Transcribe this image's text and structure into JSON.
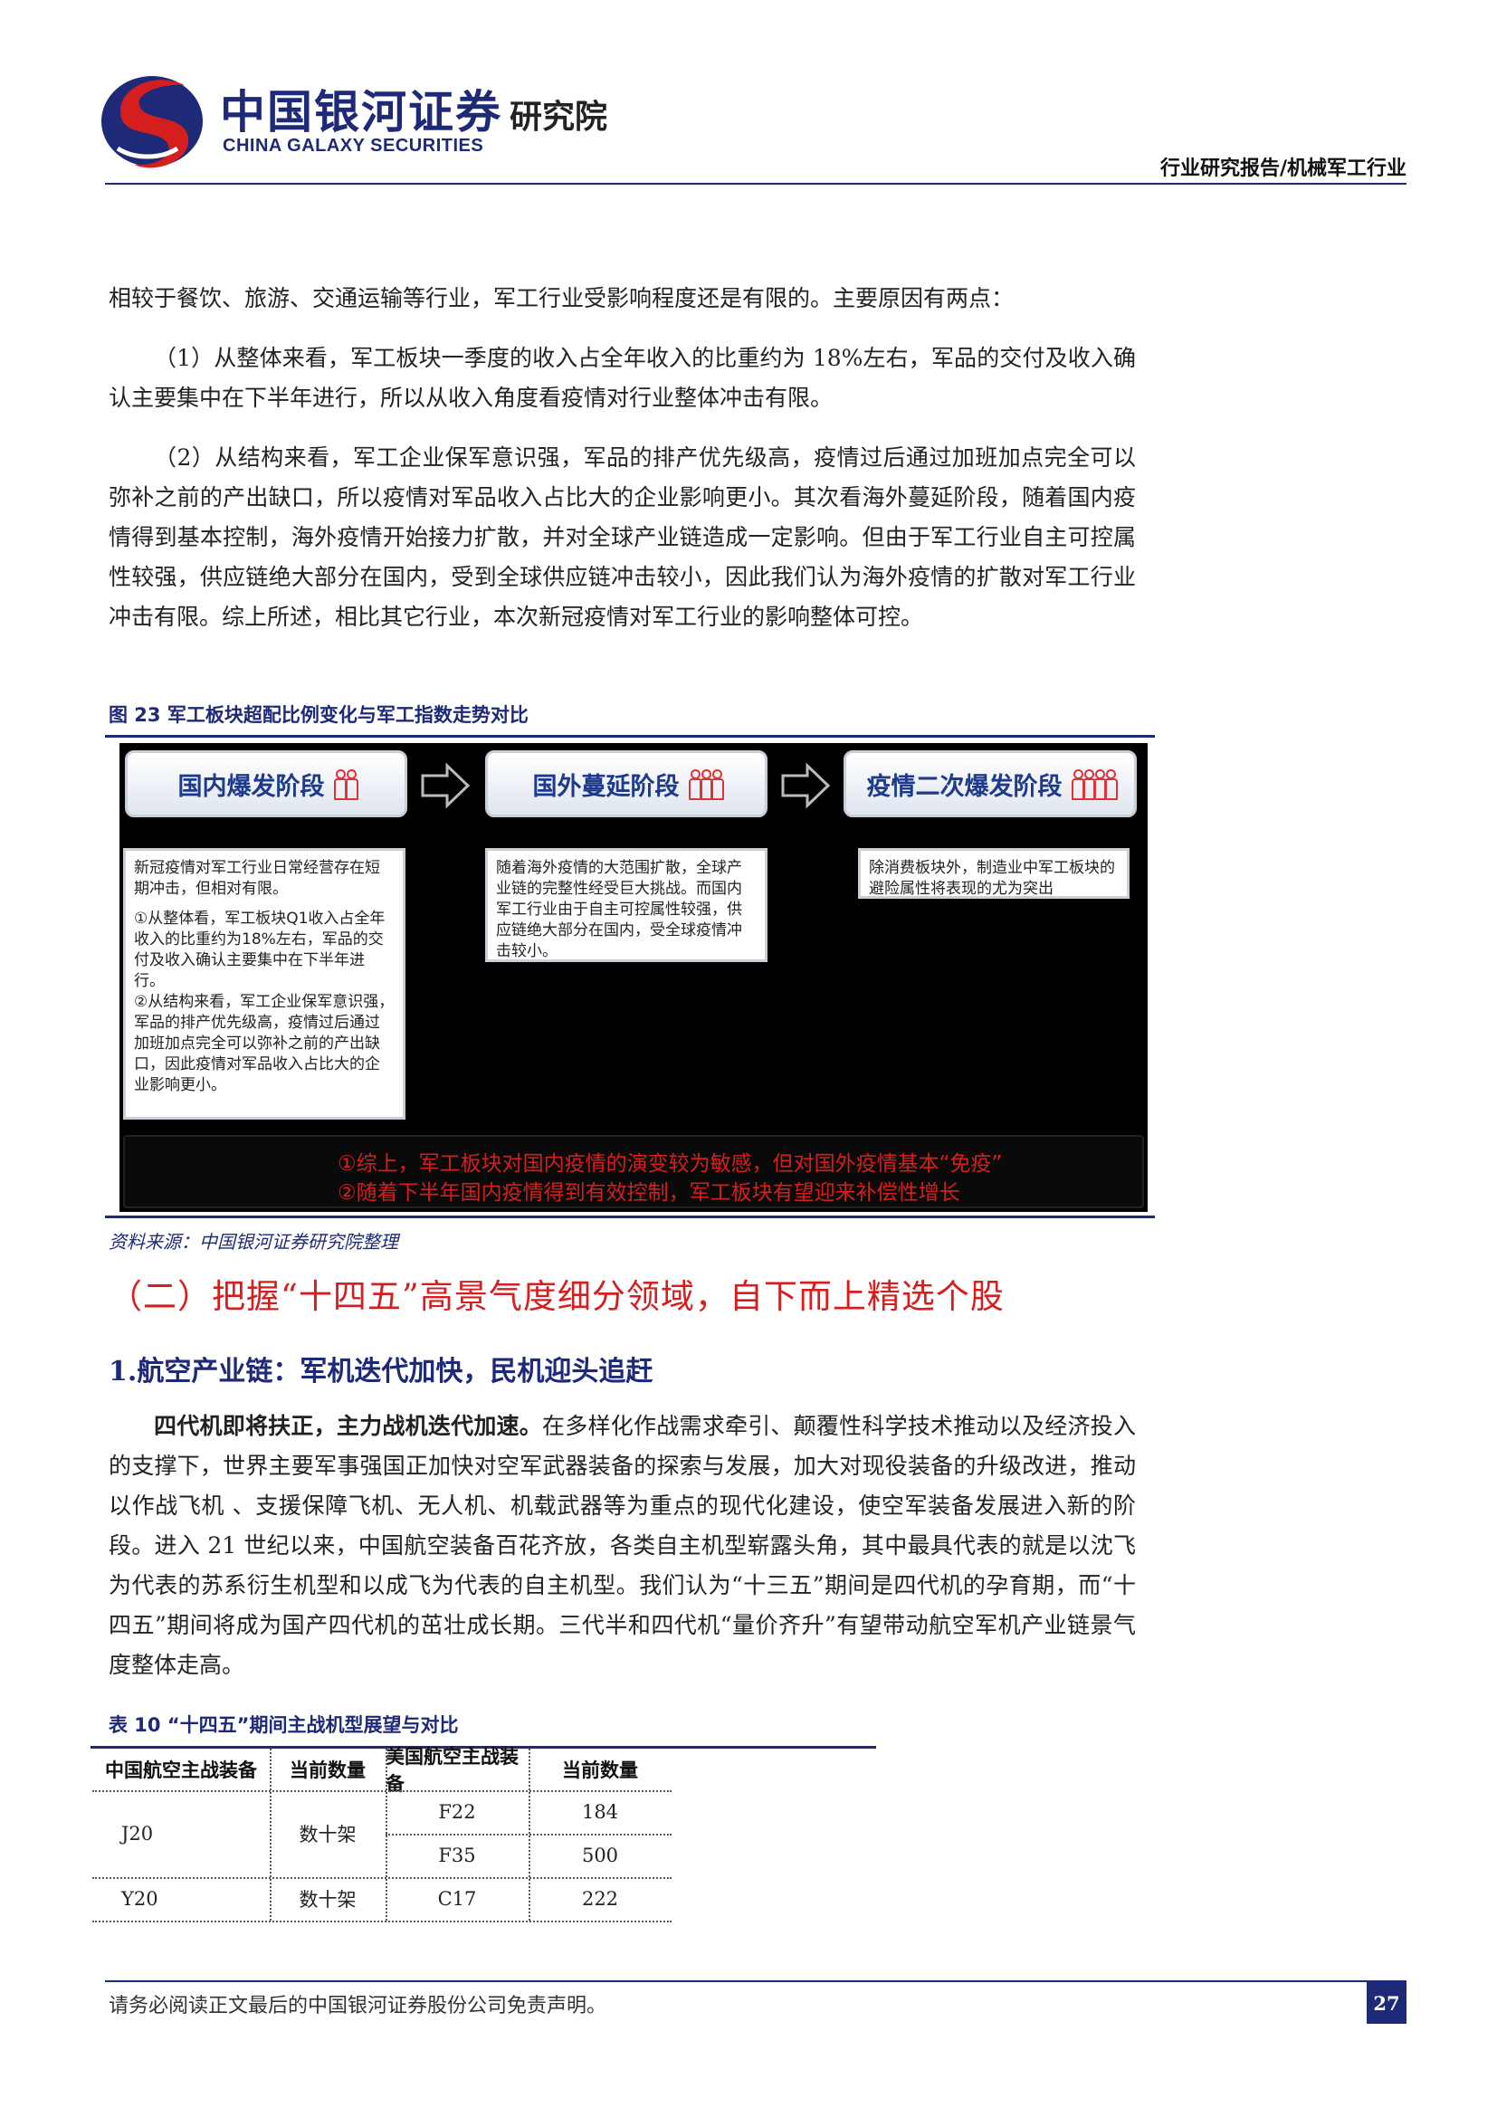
{
  "header": {
    "logo_cn": "中国银河证券",
    "logo_en": "CHINA GALAXY SECURITIES",
    "logo_institute": "研究院",
    "report_type": "行业研究报告/机械军工行业",
    "brand_color": "#1e2a78",
    "accent_color": "#d51f1f"
  },
  "body": {
    "p1": "相较于餐饮、旅游、交通运输等行业，军工行业受影响程度还是有限的。主要原因有两点：",
    "p2": "（1）从整体来看，军工板块一季度的收入占全年收入的比重约为 18%左右，军品的交付及收入确认主要集中在下半年进行，所以从收入角度看疫情对行业整体冲击有限。",
    "p3": "（2）从结构来看，军工企业保军意识强，军品的排产优先级高，疫情过后通过加班加点完全可以弥补之前的产出缺口，所以疫情对军品收入占比大的企业影响更小。其次看海外蔓延阶段，随着国内疫情得到基本控制，海外疫情开始接力扩散，并对全球产业链造成一定影响。但由于军工行业自主可控属性较强，供应链绝大部分在国内，受到全球供应链冲击较小，因此我们认为海外疫情的扩散对军工行业冲击有限。综上所述，相比其它行业，本次新冠疫情对军工行业的影响整体可控。"
  },
  "figure": {
    "caption": "图 23 军工板块超配比例变化与军工指数走势对比",
    "phases": [
      {
        "label": "国内爆发阶段",
        "icon": "people-icon"
      },
      {
        "label": "国外蔓延阶段",
        "icon": "crowd-icon"
      },
      {
        "label": "疫情二次爆发阶段",
        "icon": "crowd-icon"
      }
    ],
    "card1_p1": "新冠疫情对军工行业日常经营存在短期冲击，但相对有限。",
    "card1_p2": "①从整体看，军工板块Q1收入占全年收入的比重约为18%左右，军品的交付及收入确认主要集中在下半年进行。",
    "card1_p3": "②从结构来看，军工企业保军意识强，军品的排产优先级高，疫情过后通过加班加点完全可以弥补之前的产出缺口，因此疫情对军品收入占比大的企业影响更小。",
    "card2": "随着海外疫情的大范围扩散，全球产业链的完整性经受巨大挑战。而国内军工行业由于自主可控属性较强，供应链绝大部分在国内，受全球疫情冲击较小。",
    "card3": "除消费板块外，制造业中军工板块的避险属性将表现的尤为突出",
    "summary1": "①综上，军工板块对国内疫情的演变较为敏感，但对国外疫情基本“免疫”",
    "summary2": "②随着下半年国内疫情得到有效控制，军工板块有望迎来补偿性增长",
    "source": "资料来源：中国银河证券研究院整理"
  },
  "section": {
    "title": "（二）把握“十四五”高景气度细分领域，自下而上精选个股",
    "subtitle": "1.航空产业链：军机迭代加快，民机迎头追赶",
    "lead": "四代机即将扶正，主力战机迭代加速。",
    "text": "在多样化作战需求牵引、颠覆性科学技术推动以及经济投入的支撑下，世界主要军事强国正加快对空军武器装备的探索与发展，加大对现役装备的升级改进，推动以作战飞机 、支援保障飞机、无人机、机载武器等为重点的现代化建设，使空军装备发展进入新的阶段。进入 21 世纪以来，中国航空装备百花齐放，各类自主机型崭露头角，其中最具代表的就是以沈飞为代表的苏系衍生机型和以成飞为代表的自主机型。我们认为“十三五”期间是四代机的孕育期，而“十四五”期间将成为国产四代机的茁壮成长期。三代半和四代机“量价齐升”有望带动航空军机产业链景气度整体走高。"
  },
  "table": {
    "caption": "表 10 “十四五”期间主战机型展望与对比",
    "headers": [
      "中国航空主战装备",
      "当前数量",
      "美国航空主战装备",
      "当前数量"
    ],
    "rows": [
      {
        "cn": "J20",
        "cn_count": "数十架",
        "us": [
          "F22",
          "F35"
        ],
        "us_count": [
          "184",
          "500"
        ]
      },
      {
        "cn": "Y20",
        "cn_count": "数十架",
        "us": [
          "C17"
        ],
        "us_count": [
          "222"
        ]
      }
    ]
  },
  "footer": {
    "disclaimer": "请务必阅读正文最后的中国银河证券股份公司免责声明。",
    "page": "27"
  }
}
